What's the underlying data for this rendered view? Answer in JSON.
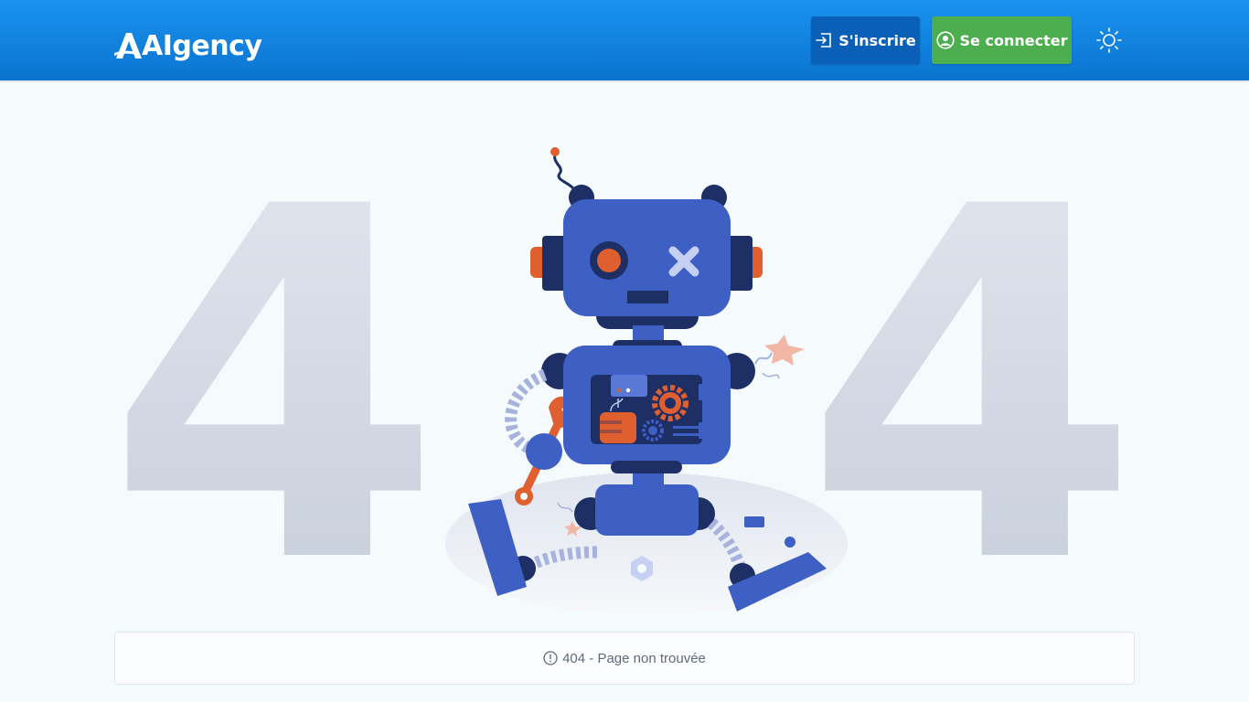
{
  "header": {
    "logo_text": "AIgency",
    "signup_label": "S'inscrire",
    "login_label": "Se connecter",
    "theme_toggle_icon": "sun-icon"
  },
  "error": {
    "left_digit": "4",
    "right_digit": "4",
    "message": "404 - Page non trouvée",
    "message_icon": "exclamation-circle-icon"
  },
  "colors": {
    "header_start": "#1a93ef",
    "header_end": "#0a74d0",
    "signup_bg": "#0a5fb6",
    "login_bg": "#4cae4f",
    "robot_blue": "#3e5fc4",
    "robot_dark": "#1e2f66",
    "robot_orange": "#df5f2e",
    "digit_gray": "#c7cfdc"
  }
}
